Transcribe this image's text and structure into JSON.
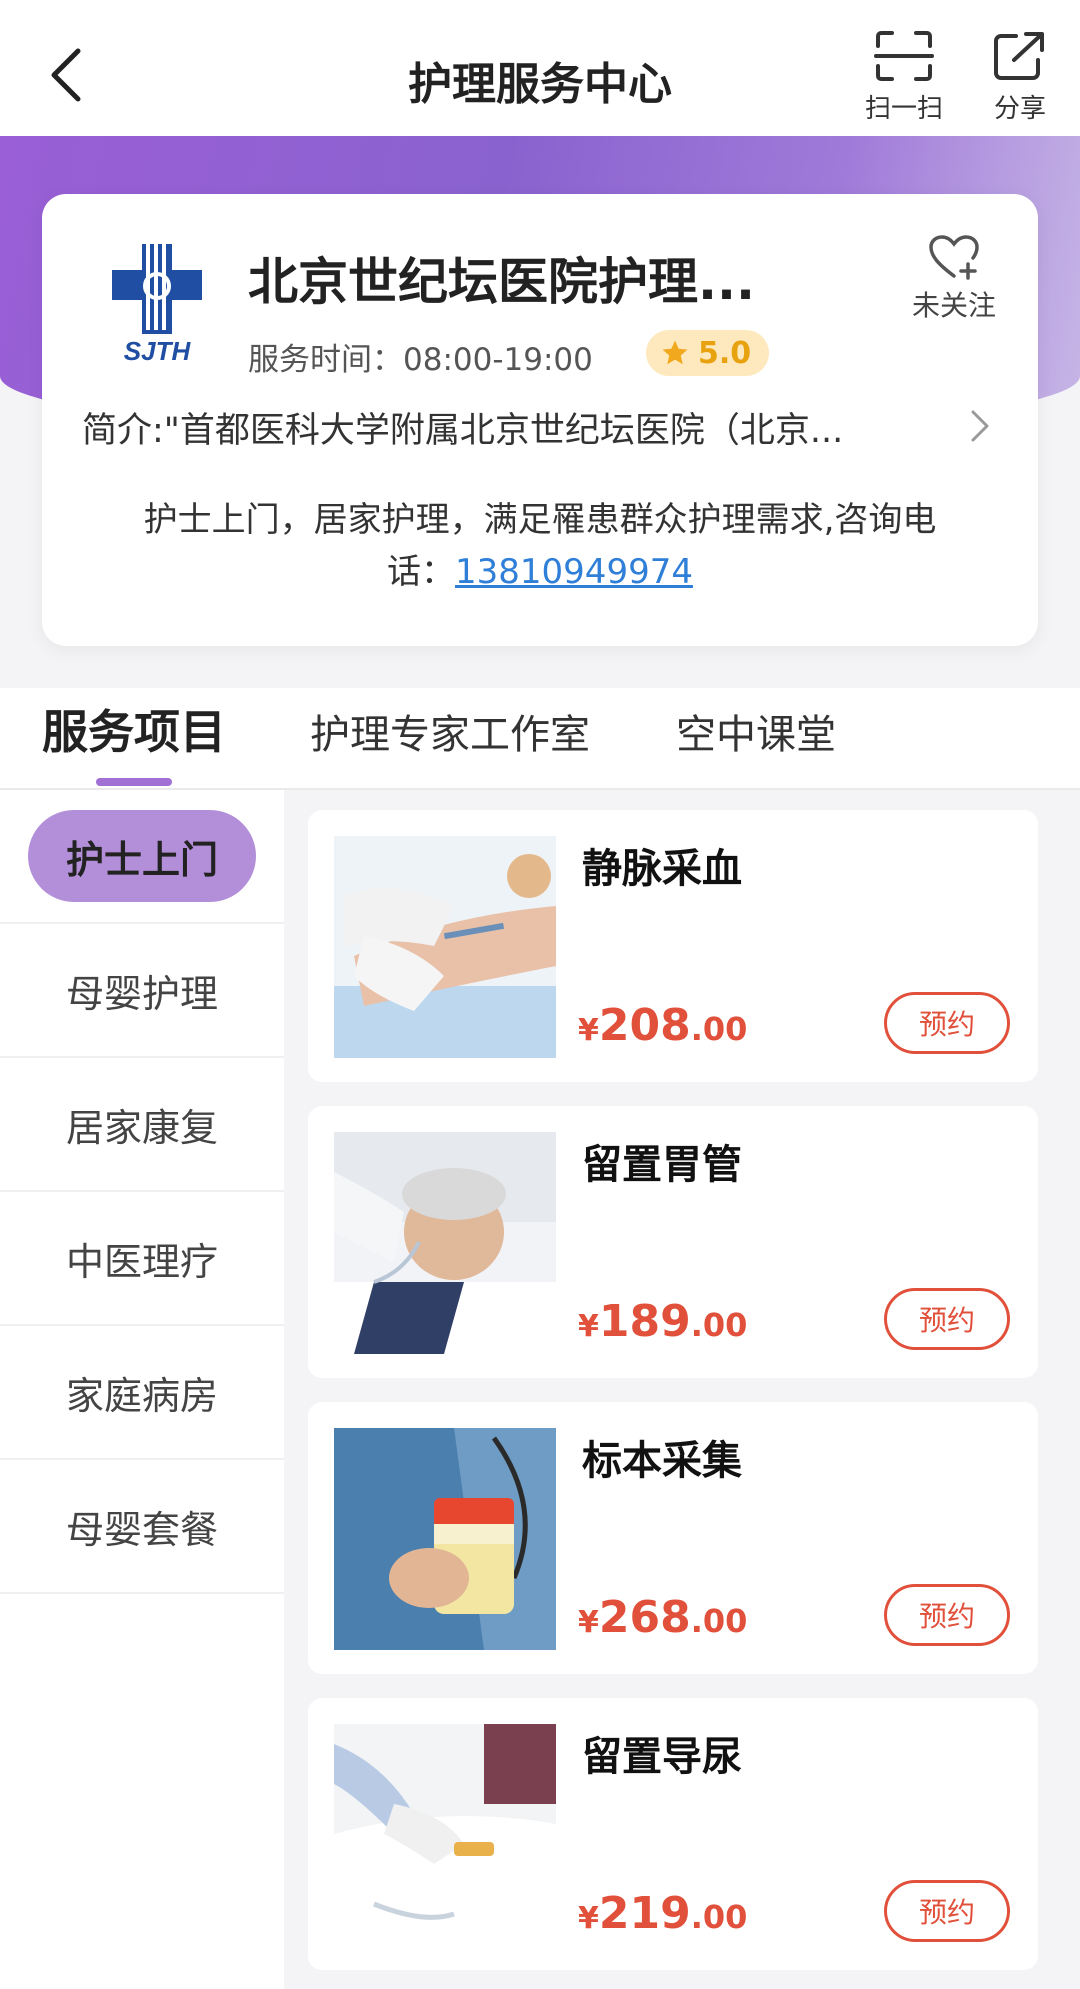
{
  "header": {
    "title": "护理服务中心",
    "scan_label": "扫一扫",
    "share_label": "分享"
  },
  "hospital": {
    "name": "北京世纪坛医院护理...",
    "logo_text": "SJTH",
    "follow_label": "未关注",
    "service_time": "服务时间：08:00-19:00",
    "rating": "5.0",
    "intro": "简介:\"首都医科大学附属北京世纪坛医院（北京...",
    "desc_line1": "护士上门，居家护理，满足罹患群众护理需求,咨询电",
    "desc_prefix": "话：",
    "phone": "13810949974"
  },
  "tabs": [
    {
      "label": "服务项目",
      "active": true
    },
    {
      "label": "护理专家工作室",
      "active": false
    },
    {
      "label": "空中课堂",
      "active": false
    }
  ],
  "categories": [
    {
      "label": "护士上门",
      "active": true
    },
    {
      "label": "母婴护理",
      "active": false
    },
    {
      "label": "居家康复",
      "active": false
    },
    {
      "label": "中医理疗",
      "active": false
    },
    {
      "label": "家庭病房",
      "active": false
    },
    {
      "label": "母婴套餐",
      "active": false
    }
  ],
  "products": [
    {
      "name": "静脉采血",
      "symbol": "¥",
      "price_int": "208",
      "price_dec": ".00",
      "book_label": "预约",
      "image": "blood-draw-photo"
    },
    {
      "name": "留置胃管",
      "symbol": "¥",
      "price_int": "189",
      "price_dec": ".00",
      "book_label": "预约",
      "image": "gastric-tube-photo"
    },
    {
      "name": "标本采集",
      "symbol": "¥",
      "price_int": "268",
      "price_dec": ".00",
      "book_label": "预约",
      "image": "specimen-photo"
    },
    {
      "name": "留置导尿",
      "symbol": "¥",
      "price_int": "219",
      "price_dec": ".00",
      "book_label": "预约",
      "image": "catheter-photo"
    }
  ],
  "colors": {
    "accent_purple": "#a070d4",
    "price_red": "#e1503a",
    "rating_gold": "#e8a20f",
    "link_blue": "#2f7fd8"
  }
}
